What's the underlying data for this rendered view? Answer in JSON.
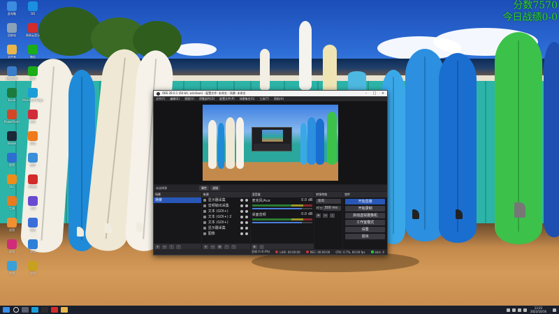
{
  "desktop": {
    "icons": [
      {
        "label": "此电脑",
        "icon": "computer-icon",
        "color": "#3c8ce0"
      },
      {
        "label": "QQ",
        "icon": "qq-icon",
        "color": "#1b8fe0"
      },
      {
        "label": "回收站",
        "icon": "recycle-bin-icon",
        "color": "#8aa2b8"
      },
      {
        "label": "网易云音乐",
        "icon": "netease-music-icon",
        "color": "#d22c2c"
      },
      {
        "label": "文件夹",
        "icon": "folder-icon",
        "color": "#e8b64a"
      },
      {
        "label": "微信",
        "icon": "wechat-icon",
        "color": "#1aad19"
      },
      {
        "label": "控制面板",
        "icon": "control-panel-icon",
        "color": "#3a7cc8"
      },
      {
        "label": "应用",
        "icon": "app-icon",
        "color": "#1aad19"
      },
      {
        "label": "Excel",
        "icon": "excel-icon",
        "color": "#1d7a3e"
      },
      {
        "label": "Microsoft Edge",
        "icon": "edge-icon",
        "color": "#1b9dd8"
      },
      {
        "label": "PowerPoint",
        "icon": "powerpoint-icon",
        "color": "#d24726"
      },
      {
        "label": "应用",
        "icon": "heart-icon",
        "color": "#d02c3a"
      },
      {
        "label": "Steam",
        "icon": "steam-icon",
        "color": "#1b2838"
      },
      {
        "label": "游戏",
        "icon": "game-icon",
        "color": "#f07a1a"
      },
      {
        "label": "程序",
        "icon": "blue-app-icon",
        "color": "#2d6fd0"
      },
      {
        "label": "程序",
        "icon": "app-icon",
        "color": "#3a8fd8"
      },
      {
        "label": "VLC",
        "icon": "vlc-icon",
        "color": "#f08c1a"
      },
      {
        "label": "网易云",
        "icon": "music-icon",
        "color": "#d22c2c"
      },
      {
        "label": "工具",
        "icon": "orange-app-icon",
        "color": "#e87a20"
      },
      {
        "label": "工具",
        "icon": "purple-app-icon",
        "color": "#6a4ad0"
      },
      {
        "label": "应用",
        "icon": "orange-app-icon",
        "color": "#f09030"
      },
      {
        "label": "游戏",
        "icon": "globe-icon",
        "color": "#3a6ed8"
      },
      {
        "label": "应用",
        "icon": "pink-app-icon",
        "color": "#d02c7a"
      },
      {
        "label": "应用",
        "icon": "blue-app-icon",
        "color": "#2d7fd8"
      },
      {
        "label": "应用",
        "icon": "app-icon",
        "color": "#3aa0d8"
      },
      {
        "label": "应用",
        "icon": "photo-icon",
        "color": "#c8a020"
      }
    ]
  },
  "score": {
    "line1": "分数7570",
    "line2": "今日战绩0-0"
  },
  "obs": {
    "title": "OBS 28.0.1 (64-bit, windows) - 配置文件: 未命名 - 场景: 未命名",
    "menu": [
      "文件(F)",
      "编辑(E)",
      "视图(V)",
      "停靠部件(D)",
      "配置文件(P)",
      "场景集合(S)",
      "工具(T)",
      "帮助(H)"
    ],
    "scenebar": {
      "label": "未选择源",
      "props": "属性",
      "filters": "滤镜"
    },
    "docks": {
      "scenes": {
        "title": "场景",
        "items": [
          "场景"
        ]
      },
      "sources": {
        "title": "来源",
        "items": [
          "显示器采集",
          "音频输出采集",
          "文本 (GDI+)",
          "文本 (GDI+) 2",
          "文本 (GDI+)",
          "显示器采集",
          "图像"
        ]
      },
      "mixer": {
        "title": "混音器",
        "channels": [
          {
            "name": "麦克风/Aux",
            "db": "0.0 dB"
          },
          {
            "name": "桌面音频",
            "db": "0.0 dB"
          }
        ]
      },
      "transitions": {
        "title": "转场特效",
        "type": "淡出",
        "duration_label": "时长",
        "duration": "300 ms"
      },
      "controls": {
        "title": "控件",
        "buttons": [
          "开始直播",
          "开始录制",
          "启动虚拟摄像机",
          "工作室模式",
          "设置",
          "退出"
        ]
      }
    },
    "status": {
      "dropped": "丢帧 0 (0.0%)",
      "live": "LIVE: 00:00:00",
      "rec": "REC: 00:00:00",
      "cpu": "CPU: 0.7%, 60.00 fps",
      "kbps": "kb/s: 0"
    }
  },
  "taskbar": {
    "time": "13:22",
    "date": "2022/10/16",
    "apps": [
      {
        "icon": "windows-start-icon",
        "color": "#3b8eea"
      },
      {
        "icon": "task-view-icon",
        "color": "#5a6070"
      },
      {
        "icon": "edge-icon",
        "color": "#1b9dd8"
      },
      {
        "icon": "obs-icon",
        "color": "#2a2a2e"
      },
      {
        "icon": "netease-music-icon",
        "color": "#d22c2c"
      },
      {
        "icon": "file-explorer-icon",
        "color": "#e8b64a"
      }
    ]
  }
}
